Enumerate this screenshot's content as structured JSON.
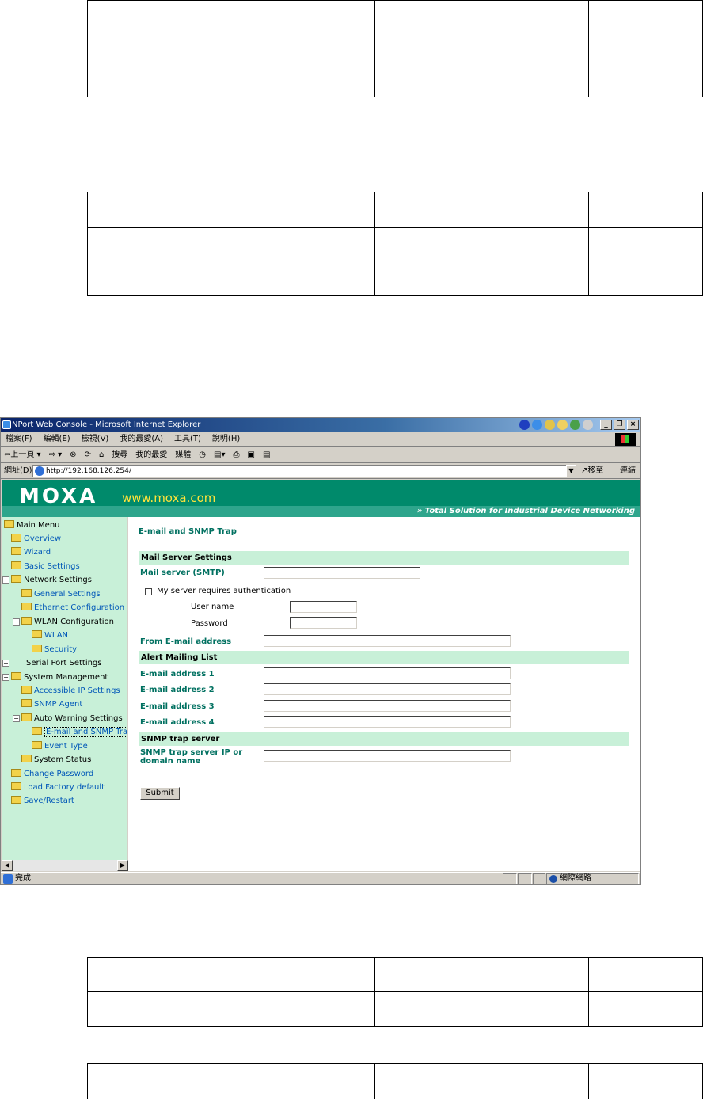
{
  "window": {
    "title": "NPort Web Console - Microsoft Internet Explorer",
    "menu": [
      "檔案(F)",
      "編輯(E)",
      "檢視(V)",
      "我的最愛(A)",
      "工具(T)",
      "說明(H)"
    ],
    "toolbar": [
      "⇦上一頁 ▾",
      "⇨ ▾",
      "⊗",
      "⟳",
      "⌂",
      "搜尋",
      "我的最愛",
      "媒體",
      "◷",
      "▤▾",
      "⎙",
      "▣",
      "▤"
    ],
    "address_label": "網址(D)",
    "url": "http://192.168.126.254/",
    "go_label": "移至",
    "links_label": "連結 »",
    "status_text": "完成",
    "zone_text": "網際網路"
  },
  "banner": {
    "logo": "MOXA",
    "site": "www.moxa.com",
    "slogan": "» Total Solution for Industrial Device Networking"
  },
  "tree": [
    {
      "label": "Main Menu"
    },
    {
      "label": "Overview"
    },
    {
      "label": "Wizard"
    },
    {
      "label": "Basic Settings"
    },
    {
      "label": "Network Settings"
    },
    {
      "label": "General Settings"
    },
    {
      "label": "Ethernet Configuration"
    },
    {
      "label": "WLAN Configuration"
    },
    {
      "label": "WLAN"
    },
    {
      "label": "Security"
    },
    {
      "label": "Serial Port Settings"
    },
    {
      "label": "System Management"
    },
    {
      "label": "Accessible IP Settings"
    },
    {
      "label": "SNMP Agent"
    },
    {
      "label": "Auto Warning Settings"
    },
    {
      "label": "E-mail and SNMP Trap"
    },
    {
      "label": "Event Type"
    },
    {
      "label": "System Status"
    },
    {
      "label": "Change Password"
    },
    {
      "label": "Load Factory default"
    },
    {
      "label": "Save/Restart"
    }
  ],
  "form": {
    "title": "E-mail and SNMP Trap",
    "mail_section": "Mail Server Settings",
    "mail_server_label": "Mail server (SMTP)",
    "auth_label": "My server requires authentication",
    "username_label": "User name",
    "password_label": "Password",
    "from_label": "From E-mail address",
    "alert_section": "Alert Mailing List",
    "email1_label": "E-mail address 1",
    "email2_label": "E-mail address 2",
    "email3_label": "E-mail address 3",
    "email4_label": "E-mail address 4",
    "snmp_section": "SNMP trap server",
    "snmp_label_line1": "SNMP trap server IP or",
    "snmp_label_line2": "domain name",
    "submit_label": "Submit"
  },
  "colors": {
    "banner": "#008a6b",
    "sidebar": "#c8f0d8",
    "section_bar": "#c8f0d8",
    "field_label": "#007060",
    "link": "#0057b8"
  }
}
